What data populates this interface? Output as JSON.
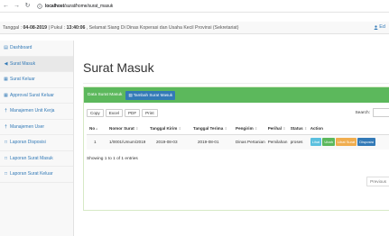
{
  "browser": {
    "url_host": "localhost",
    "url_path": "/surat/home/surat_masuk"
  },
  "topbar": {
    "date_label": "Tanggal : ",
    "date": "04-08-2019",
    "sep": " | Pukul : ",
    "time": "13:40:06",
    "welcome": " , Selamat Siang Di Dinas Koperasi dan Usaha Kecil Provinsi (Sekretariat)",
    "user_label": "Ed"
  },
  "sidebar": {
    "items": [
      {
        "label": "Dashboard",
        "icon": "dashboard-icon"
      },
      {
        "label": "Surat Masuk",
        "icon": "inbox-icon"
      },
      {
        "label": "Surat Keluar",
        "icon": "outbox-icon"
      },
      {
        "label": "Approval Surat Keluar",
        "icon": "approval-icon"
      },
      {
        "label": "Manajemen Unit Kerja",
        "icon": "building-icon"
      },
      {
        "label": "Manajemen User",
        "icon": "user-icon"
      },
      {
        "label": "Laporan Disposisi",
        "icon": "report-icon"
      },
      {
        "label": "Laporan Surat Masuk",
        "icon": "report-icon"
      },
      {
        "label": "Laporan Surat Keluar",
        "icon": "report-icon"
      }
    ]
  },
  "main": {
    "title": "Surat Masuk",
    "panel_title": "Data Surat Masuk",
    "add_button": "Tambah Surat Masuk",
    "toolbar": [
      "Copy",
      "Excel",
      "PDF",
      "Print"
    ],
    "search_label": "Search:",
    "columns": [
      "No",
      "Nomor Surat",
      "Tanggal Kirim",
      "Tanggal Terima",
      "Pengirim",
      "Perihal",
      "Status",
      "Action"
    ],
    "rows": [
      {
        "no": "1",
        "nomor": "1/0001/Umum/2019",
        "kirim": "2019-08-03",
        "terima": "2019-08-01",
        "pengirim": "Dinas Pertanian",
        "perihal": "Pemilahan",
        "status": "proses",
        "actions": [
          "Lihat",
          "Ubah",
          "Lihat Surat",
          "Disposisi"
        ]
      }
    ],
    "info": "Showing 1 to 1 of 1 entries",
    "prev_label": "Previous"
  },
  "colors": {
    "panel_green": "#5cb85c",
    "primary": "#337ab7",
    "info": "#5bc0de",
    "success": "#5cb85c",
    "warning": "#f0ad4e"
  }
}
